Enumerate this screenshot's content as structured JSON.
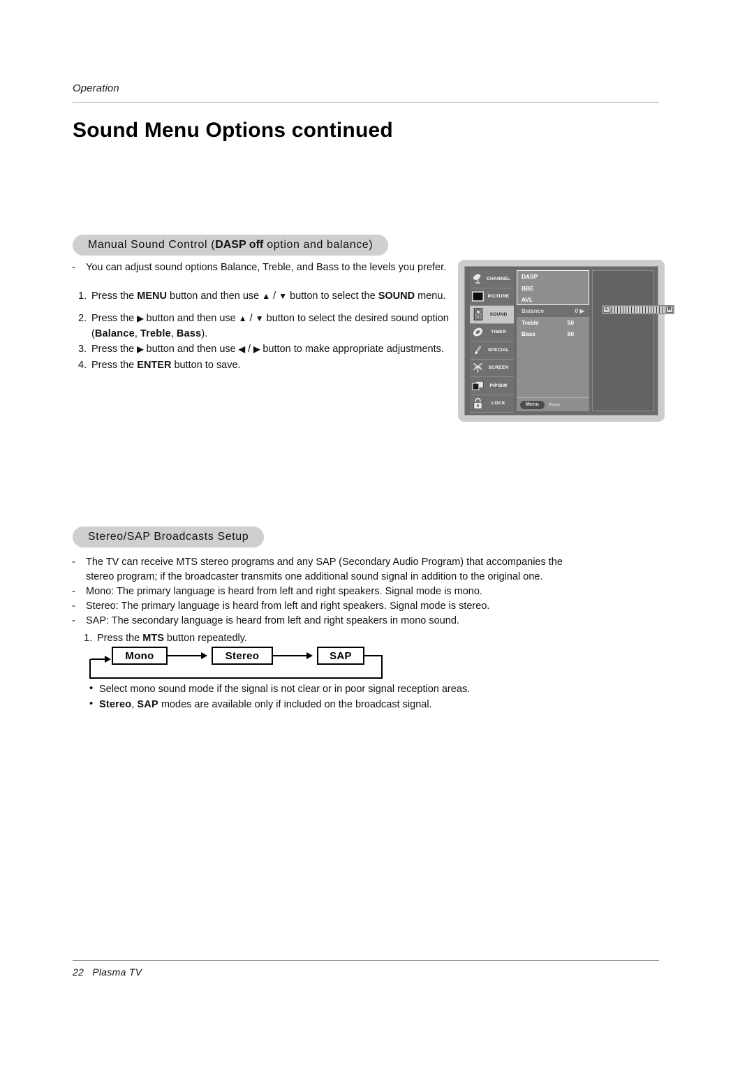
{
  "header": {
    "running_head": "Operation",
    "page_title": "Sound Menu Options continued"
  },
  "section_manual": {
    "heading_prefix": "Manual Sound Control (",
    "heading_bold": "DASP off",
    "heading_suffix": " option and balance)",
    "intro": {
      "dash": "-",
      "text": "You can adjust sound options Balance, Treble, and Bass to the levels you prefer."
    },
    "steps": [
      {
        "num": "1.",
        "p1": "Press the ",
        "b1": "MENU",
        "p2": " button and then use ",
        "a1": "▲",
        "sep": " / ",
        "a2": "▼",
        "p3": " button to select the ",
        "b2": "SOUND",
        "p4": " menu."
      },
      {
        "num": "2.",
        "p1": "Press the ",
        "a1": "▶",
        "p2": " button and then use ",
        "a2": "▲",
        "sep": " / ",
        "a3": "▼",
        "p3": " button to select the desired sound option",
        "line2_open": "(",
        "opt1": "Balance",
        "c1": ", ",
        "opt2": "Treble",
        "c2": ", ",
        "opt3": "Bass",
        "line2_close": ")."
      },
      {
        "num": "3.",
        "p1": "Press the ",
        "a1": "▶",
        "p2": " button and then use ",
        "a2": "◀",
        "sep": " / ",
        "a3": "▶",
        "p3": " button to make appropriate adjustments."
      },
      {
        "num": "4.",
        "p1": "Press the ",
        "b1": "ENTER",
        "p2": " button to save."
      }
    ]
  },
  "osd": {
    "sidebar": [
      {
        "label": "CHANNEL",
        "icon": "satellite-dish-icon",
        "active": false
      },
      {
        "label": "PICTURE",
        "icon": "tv-screen-icon",
        "active": false
      },
      {
        "label": "SOUND",
        "icon": "speaker-icon",
        "active": true
      },
      {
        "label": "TIMER",
        "icon": "clock-icon",
        "active": false
      },
      {
        "label": "SPECIAL",
        "icon": "remote-control-icon",
        "active": false
      },
      {
        "label": "SCREEN",
        "icon": "antenna-icon",
        "active": false
      },
      {
        "label": "PIP/DW",
        "icon": "windows-overlap-icon",
        "active": false
      },
      {
        "label": "LOCK",
        "icon": "padlock-icon",
        "active": false
      }
    ],
    "menu_top": [
      {
        "label": "DASP",
        "value": ""
      },
      {
        "label": "BBE",
        "value": ""
      },
      {
        "label": "AVL",
        "value": ""
      }
    ],
    "menu_bottom": [
      {
        "label": "Balance",
        "value": "0",
        "caret": "▶",
        "selected": true
      },
      {
        "label": "Treble",
        "value": "50",
        "caret": "",
        "selected": false
      },
      {
        "label": "Bass",
        "value": "50",
        "caret": "",
        "selected": false
      }
    ],
    "footer": {
      "menu_button": "Menu",
      "prev_label": "Prev."
    },
    "balance_slider": {
      "left_label": "L",
      "right_label": "R",
      "value": "0"
    },
    "colors": {
      "frame": "#cdcdcd",
      "panel": "#6a6a6a",
      "list": "#8e8e8e",
      "active_item": "#c7c7c7",
      "right_panel": "#636363"
    }
  },
  "section_stereo": {
    "heading": "Stereo/SAP Broadcasts Setup",
    "dashes": [
      {
        "dash": "-",
        "text": "The TV can receive MTS stereo programs and any SAP (Secondary Audio Program) that accompanies the stereo program; if the broadcaster transmits one additional sound signal in addition to the original one."
      },
      {
        "dash": "-",
        "text": "Mono: The primary language is heard from left and right speakers. Signal mode is mono."
      },
      {
        "dash": "-",
        "text": "Stereo: The primary language is heard from left and right speakers. Signal mode is stereo."
      },
      {
        "dash": "-",
        "text": "SAP: The secondary language is heard from left and right speakers in mono sound."
      }
    ],
    "step": {
      "num": "1.",
      "p1": "Press the ",
      "b1": "MTS",
      "p2": " button repeatedly."
    },
    "flow": {
      "boxes": [
        "Mono",
        "Stereo",
        "SAP"
      ]
    },
    "bullets": [
      {
        "bullet": "•",
        "p1": "Select mono sound mode if the signal is not clear or in poor signal reception areas.",
        "b1": "",
        "p2": "",
        "b2": "",
        "p3": ""
      },
      {
        "bullet": "•",
        "p1": "",
        "b1": "Stereo",
        "p2": ", ",
        "b2": "SAP",
        "p3": " modes are available only if included on the broadcast signal."
      }
    ]
  },
  "footer": {
    "page_number": "22",
    "product": "Plasma TV"
  }
}
